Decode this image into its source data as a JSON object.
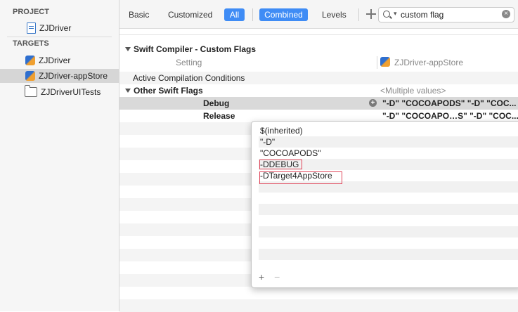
{
  "navigator": {
    "project_header": "PROJECT",
    "project_item": "ZJDriver",
    "targets_header": "TARGETS",
    "targets": [
      {
        "label": "ZJDriver",
        "selected": false,
        "icon": "app-icon"
      },
      {
        "label": "ZJDriver-appStore",
        "selected": true,
        "icon": "app-icon"
      },
      {
        "label": "ZJDriverUITests",
        "selected": false,
        "icon": "folder-icon"
      }
    ]
  },
  "filterbar": {
    "basic": "Basic",
    "customized": "Customized",
    "all": "All",
    "combined": "Combined",
    "levels": "Levels",
    "search_value": "custom flag",
    "accent": "#3f8cf5"
  },
  "settings": {
    "section_title": "Swift Compiler - Custom Flags",
    "setting_header": "Setting",
    "target_column": "ZJDriver-appStore",
    "active_conditions": "Active Compilation Conditions",
    "other_flags": "Other Swift Flags",
    "multiple_values": "<Multiple values>",
    "debug_label": "Debug",
    "debug_value": "\"-D\" \"COCOAPODS\" \"-D\" \"COC...",
    "release_label": "Release",
    "release_value": "\"-D\" \"COCOAPO…S\" \"-D\" \"COC..."
  },
  "popover": {
    "entries": [
      "$(inherited)",
      "\"-D\"",
      "\"COCOAPODS\"",
      "-DDEBUG",
      "-DTarget4AppStore"
    ],
    "add_symbol": "+",
    "remove_symbol": "−",
    "highlight_color": "#e0465a"
  }
}
